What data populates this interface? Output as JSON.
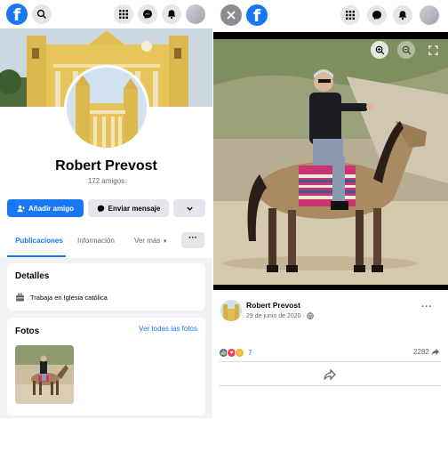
{
  "left_topbar": {
    "logo": "f",
    "icons": [
      "search-icon",
      "menu-grid-icon",
      "messenger-icon",
      "notifications-bell-icon"
    ]
  },
  "profile": {
    "name": "Robert Prevost",
    "friends": "172 amigos",
    "actions": {
      "add_friend": "Añadir amigo",
      "send_message": "Enviar mensaje"
    }
  },
  "tabs": {
    "posts": "Publicaciones",
    "info": "Información",
    "more": "Ver más",
    "more_dots": "···"
  },
  "details": {
    "title": "Detalles",
    "work": "Trabaja en Iglesia católica"
  },
  "photos": {
    "title": "Fotos",
    "see_all": "Ver todas las fotos"
  },
  "viewer": {
    "logo": "f",
    "poster_name": "Robert Prevost",
    "date": "29 de junio de 2020 ·",
    "more": "···",
    "reaction_count": "7",
    "share_count": "2282"
  },
  "colors": {
    "brand_blue": "#1877f2",
    "page_bg": "#f0f2f5",
    "secondary_text": "#65676b"
  }
}
